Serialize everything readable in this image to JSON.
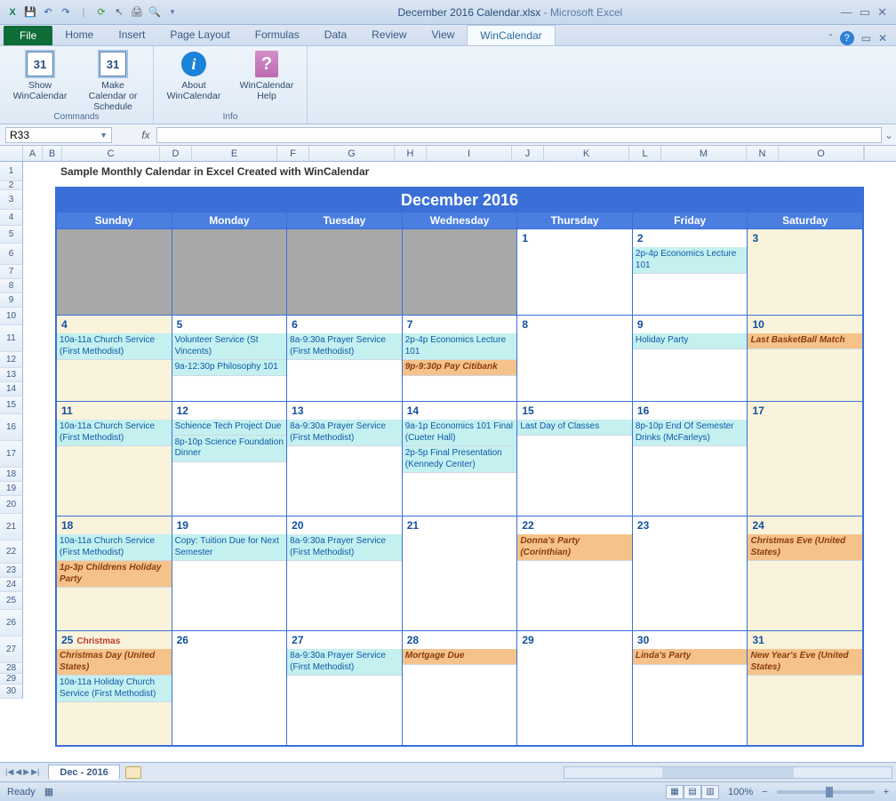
{
  "title": {
    "doc": "December 2016 Calendar.xlsx",
    "app": "Microsoft Excel"
  },
  "tabs": {
    "file": "File",
    "list": [
      "Home",
      "Insert",
      "Page Layout",
      "Formulas",
      "Data",
      "Review",
      "View",
      "WinCalendar"
    ],
    "active": "WinCalendar"
  },
  "ribbon": {
    "groups": [
      {
        "name": "Commands",
        "buttons": [
          {
            "icon": "cal31",
            "label": "Show WinCalendar"
          },
          {
            "icon": "cal31",
            "label": "Make Calendar or Schedule"
          }
        ]
      },
      {
        "name": "Info",
        "buttons": [
          {
            "icon": "iinfo",
            "label": "About WinCalendar"
          },
          {
            "icon": "helpbook",
            "label": "WinCalendar Help"
          }
        ]
      }
    ]
  },
  "namebox": "R33",
  "fx": "",
  "columns": [
    "A",
    "B",
    "C",
    "D",
    "E",
    "F",
    "G",
    "H",
    "I",
    "J",
    "K",
    "L",
    "M",
    "N",
    "O"
  ],
  "rows": [
    "1",
    "2",
    "3",
    "4",
    "5",
    "6",
    "7",
    "8",
    "9",
    "10",
    "11",
    "12",
    "13",
    "14",
    "15",
    "16",
    "17",
    "18",
    "19",
    "20",
    "21",
    "22",
    "23",
    "24",
    "25",
    "26",
    "27",
    "28",
    "29",
    "30"
  ],
  "sheetTitle": "Sample Monthly Calendar in Excel Created with WinCalendar",
  "calendar": {
    "title": "December 2016",
    "dayNames": [
      "Sunday",
      "Monday",
      "Tuesday",
      "Wednesday",
      "Thursday",
      "Friday",
      "Saturday"
    ],
    "weeks": [
      [
        {
          "inactive": true
        },
        {
          "inactive": true
        },
        {
          "inactive": true
        },
        {
          "inactive": true
        },
        {
          "n": "1"
        },
        {
          "n": "2",
          "events": [
            {
              "t": "2p-4p Economics Lecture 101",
              "c": "cyan"
            }
          ]
        },
        {
          "n": "3",
          "weekend": true
        }
      ],
      [
        {
          "n": "4",
          "weekend": true,
          "events": [
            {
              "t": "10a-11a Church Service (First Methodist)",
              "c": "cyan"
            }
          ]
        },
        {
          "n": "5",
          "events": [
            {
              "t": "Volunteer Service (St Vincents)",
              "c": "cyan"
            },
            {
              "t": "9a-12:30p Philosophy 101",
              "c": "cyan"
            }
          ]
        },
        {
          "n": "6",
          "events": [
            {
              "t": "8a-9:30a Prayer Service (First Methodist)",
              "c": "cyan"
            }
          ]
        },
        {
          "n": "7",
          "events": [
            {
              "t": "2p-4p Economics Lecture 101",
              "c": "cyan"
            },
            {
              "t": "9p-9:30p Pay Citibank",
              "c": "orange"
            }
          ]
        },
        {
          "n": "8"
        },
        {
          "n": "9",
          "events": [
            {
              "t": "Holiday Party",
              "c": "cyan"
            }
          ]
        },
        {
          "n": "10",
          "weekend": true,
          "events": [
            {
              "t": "Last BasketBall Match",
              "c": "orange"
            }
          ]
        }
      ],
      [
        {
          "n": "11",
          "weekend": true,
          "events": [
            {
              "t": "10a-11a Church Service (First Methodist)",
              "c": "cyan"
            }
          ]
        },
        {
          "n": "12",
          "events": [
            {
              "t": "Schience Tech Project Due",
              "c": "cyan"
            },
            {
              "t": "8p-10p Science Foundation Dinner",
              "c": "cyan"
            }
          ]
        },
        {
          "n": "13",
          "events": [
            {
              "t": "8a-9:30a Prayer Service (First Methodist)",
              "c": "cyan"
            }
          ]
        },
        {
          "n": "14",
          "events": [
            {
              "t": "9a-1p Economics 101 Final (Cueter Hall)",
              "c": "cyan"
            },
            {
              "t": "2p-5p Final Presentation (Kennedy Center)",
              "c": "cyan"
            }
          ]
        },
        {
          "n": "15",
          "events": [
            {
              "t": "Last Day of Classes",
              "c": "cyan"
            }
          ]
        },
        {
          "n": "16",
          "events": [
            {
              "t": "8p-10p End Of Semester Drinks (McFarleys)",
              "c": "cyan"
            }
          ]
        },
        {
          "n": "17",
          "weekend": true
        }
      ],
      [
        {
          "n": "18",
          "weekend": true,
          "events": [
            {
              "t": "10a-11a Church Service (First Methodist)",
              "c": "cyan"
            },
            {
              "t": "1p-3p Childrens Holiday Party",
              "c": "orange"
            }
          ]
        },
        {
          "n": "19",
          "events": [
            {
              "t": "Copy: Tuition Due for Next Semester",
              "c": "cyan"
            }
          ]
        },
        {
          "n": "20",
          "events": [
            {
              "t": "8a-9:30a Prayer Service (First Methodist)",
              "c": "cyan"
            }
          ]
        },
        {
          "n": "21"
        },
        {
          "n": "22",
          "events": [
            {
              "t": "Donna's Party (Corinthian)",
              "c": "orange"
            }
          ]
        },
        {
          "n": "23"
        },
        {
          "n": "24",
          "weekend": true,
          "events": [
            {
              "t": "Christmas Eve (United States)",
              "c": "orange"
            }
          ]
        }
      ],
      [
        {
          "n": "25",
          "weekend": true,
          "holiday": "Christmas",
          "events": [
            {
              "t": "Christmas Day (United States)",
              "c": "orange"
            },
            {
              "t": "10a-11a Holiday Church Service (First Methodist)",
              "c": "cyan"
            }
          ]
        },
        {
          "n": "26"
        },
        {
          "n": "27",
          "events": [
            {
              "t": "8a-9:30a Prayer Service (First Methodist)",
              "c": "cyan"
            }
          ]
        },
        {
          "n": "28",
          "events": [
            {
              "t": "Mortgage Due",
              "c": "orange"
            }
          ]
        },
        {
          "n": "29"
        },
        {
          "n": "30",
          "events": [
            {
              "t": "Linda's Party",
              "c": "orange"
            }
          ]
        },
        {
          "n": "31",
          "weekend": true,
          "events": [
            {
              "t": "New Year's Eve (United States)",
              "c": "orange"
            }
          ]
        }
      ]
    ]
  },
  "sheetTab": "Dec - 2016",
  "status": {
    "ready": "Ready",
    "zoom": "100%"
  }
}
